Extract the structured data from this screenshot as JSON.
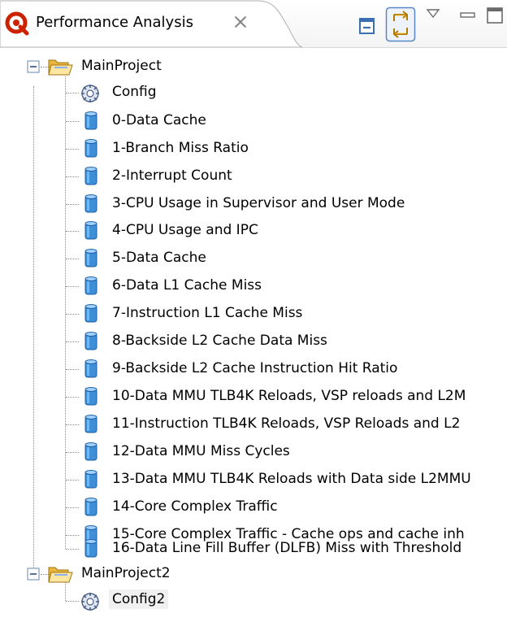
{
  "view": {
    "title": "Performance Analysis",
    "icons": {
      "app": "performance-analysis-icon",
      "close": "close-x-icon",
      "collapse_all": "collapse-all-icon",
      "link_with_editor": "link-with-editor-icon",
      "view_menu": "view-menu-icon",
      "minimize": "minimize-icon",
      "maximize": "maximize-icon"
    },
    "link_with_editor_pressed": true
  },
  "tree": {
    "projects": [
      {
        "name": "MainProject",
        "expanded": true,
        "config": "Config",
        "items": [
          "0-Data Cache",
          "1-Branch Miss Ratio",
          "2-Interrupt Count",
          "3-CPU Usage in Supervisor and User Mode",
          "4-CPU Usage and IPC",
          "5-Data Cache",
          "6-Data L1 Cache Miss",
          "7-Instruction L1 Cache Miss",
          "8-Backside L2 Cache Data Miss",
          "9-Backside L2 Cache Instruction Hit Ratio",
          "10-Data MMU TLB4K Reloads, VSP reloads and L2M",
          "11-Instruction TLB4K Reloads, VSP Reloads and L2",
          "12-Data MMU Miss Cycles",
          "13-Data MMU TLB4K Reloads with Data side L2MMU",
          "14-Core Complex Traffic",
          "15-Core Complex Traffic - Cache ops and cache inh",
          "16-Data Line Fill Buffer (DLFB) Miss with Threshold"
        ]
      },
      {
        "name": "MainProject2",
        "expanded": true,
        "config": "Config2",
        "items": []
      }
    ],
    "selected": "Config2"
  },
  "colors": {
    "accent": "#316ac5",
    "folder": "#f4cf57",
    "database": "#3e8fd8",
    "app_icon": "#cc2200",
    "tree_lines": "#8c8c8c"
  }
}
